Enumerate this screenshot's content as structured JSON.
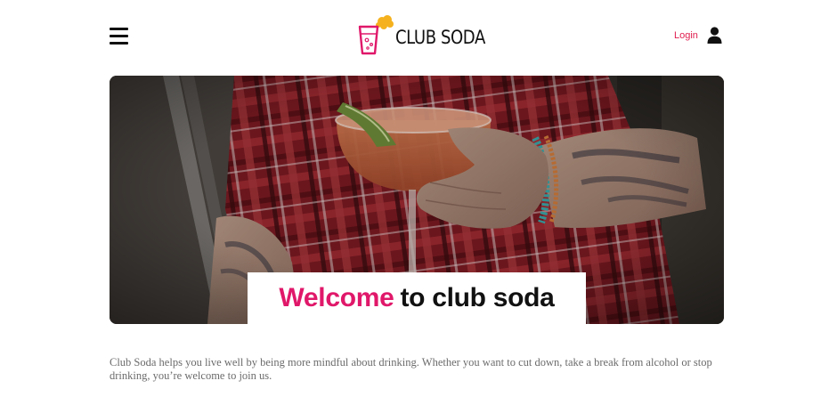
{
  "header": {
    "brand": "CLUB SODA",
    "login_label": "Login",
    "menu_icon": "hamburger-menu-icon",
    "user_icon": "user-icon"
  },
  "hero": {
    "welcome_highlight": "Welcome",
    "welcome_rest": "to club soda"
  },
  "intro": {
    "text": "Club Soda helps you live well by being more mindful about drinking. Whether you want to cut down, take a break from alcohol or stop drinking, you’re welcome to join us."
  },
  "colors": {
    "accent_pink": "#e0186a",
    "login_red": "#e02050",
    "logo_yellow": "#f5b21e"
  }
}
